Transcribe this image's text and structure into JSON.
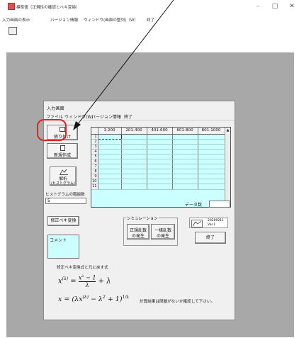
{
  "window": {
    "title": "標準値（正規性の確認とベキ変換）",
    "controls": {
      "minimize": "–",
      "maximize": "□",
      "close": "✕"
    }
  },
  "menubar": {
    "items": [
      "入力画面の表示",
      "バージョン情報",
      "ウィンドウ(画面の整列)（W）",
      "終了"
    ]
  },
  "dialog": {
    "title": "入力画面",
    "menu": [
      "ファイル",
      "ウィンドウ(W)",
      "バージョン情報",
      "終了"
    ],
    "paste_button": "張り付け",
    "new_button": "新規作成",
    "analyze_button_line1": "解析",
    "analyze_button_line2": "(ヒストグラム)",
    "histogram_classes_label": "ヒストグラムの階級数",
    "histogram_classes_value": "5",
    "grid": {
      "columns": [
        "1-200",
        "201-400",
        "401-600",
        "601-800",
        "801-1000"
      ],
      "row_numbers": [
        "1",
        "2",
        "3",
        "4",
        "5",
        "6",
        "7",
        "8",
        "9",
        "10",
        "11"
      ],
      "scroll_up": "▲",
      "scroll_down": "▼"
    },
    "data_count_label": "データ数",
    "data_count_value": "",
    "power_transform_button": "修正べキ変換",
    "comment_box": "コメント",
    "simulation_group": "シミュレーション",
    "normal_random_line1": "正規乱数",
    "normal_random_line2": "の発生",
    "uniform_random_line1": "一様乱数",
    "uniform_random_line2": "の発生",
    "version_line1": "20200211",
    "version_line2": "Ver.1",
    "exit_button": "終了",
    "formula_caption": "修正べキ変換式と元に戻す式",
    "note": "計算結果は問題がないか確認して下さい。"
  },
  "colors": {
    "grid_background": "#ccffff",
    "client_background": "#a8a8a8",
    "highlight_circle": "#e4231c"
  }
}
